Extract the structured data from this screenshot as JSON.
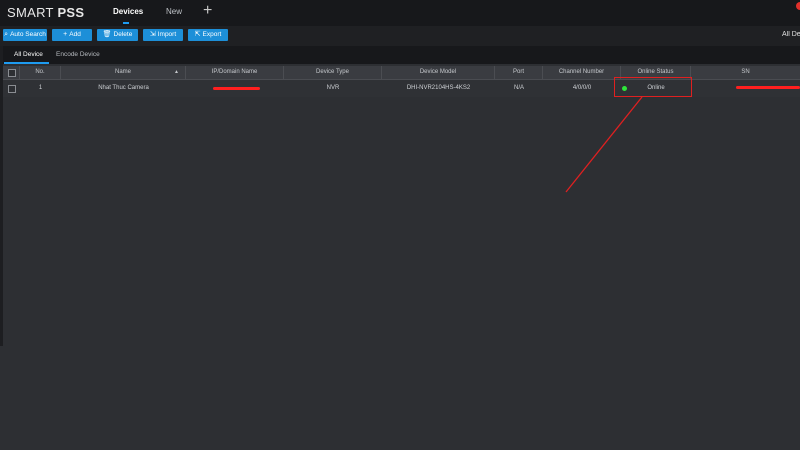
{
  "app": {
    "brand_light": "SMART ",
    "brand_bold": "PSS"
  },
  "top_tabs": [
    {
      "label": "Devices",
      "active": true
    },
    {
      "label": "New",
      "active": false
    }
  ],
  "add_tab_glyph": "+",
  "toolbar": {
    "buttons": [
      {
        "label": "Auto Search",
        "icon": "search-icon",
        "glyph": "⌕"
      },
      {
        "label": "Add",
        "icon": "plus-icon",
        "glyph": "+"
      },
      {
        "label": "Delete",
        "icon": "trash-icon",
        "glyph": "🗑"
      },
      {
        "label": "Import",
        "icon": "import-icon",
        "glyph": "⇲"
      },
      {
        "label": "Export",
        "icon": "export-icon",
        "glyph": "⇱"
      }
    ],
    "right_text": "All De"
  },
  "subtabs": [
    {
      "label": "All Device",
      "active": true
    },
    {
      "label": "Encode Device",
      "active": false
    }
  ],
  "table": {
    "columns": [
      "No.",
      "Name",
      "IP/Domain Name",
      "Device Type",
      "Device Model",
      "Port",
      "Channel Number",
      "Online Status",
      "SN"
    ],
    "rows": [
      {
        "no": "1",
        "name": "Nhat Thuc Camera",
        "ip": "",
        "device_type": "NVR",
        "device_model": "DHI-NVR2104HS-4KS2",
        "port": "N/A",
        "channel_number": "4/0/0/0",
        "online_status": "Online",
        "sn": ""
      }
    ]
  },
  "colors": {
    "accent": "#1d8fd8",
    "online": "#2ee63a",
    "annotation": "#e02020"
  }
}
